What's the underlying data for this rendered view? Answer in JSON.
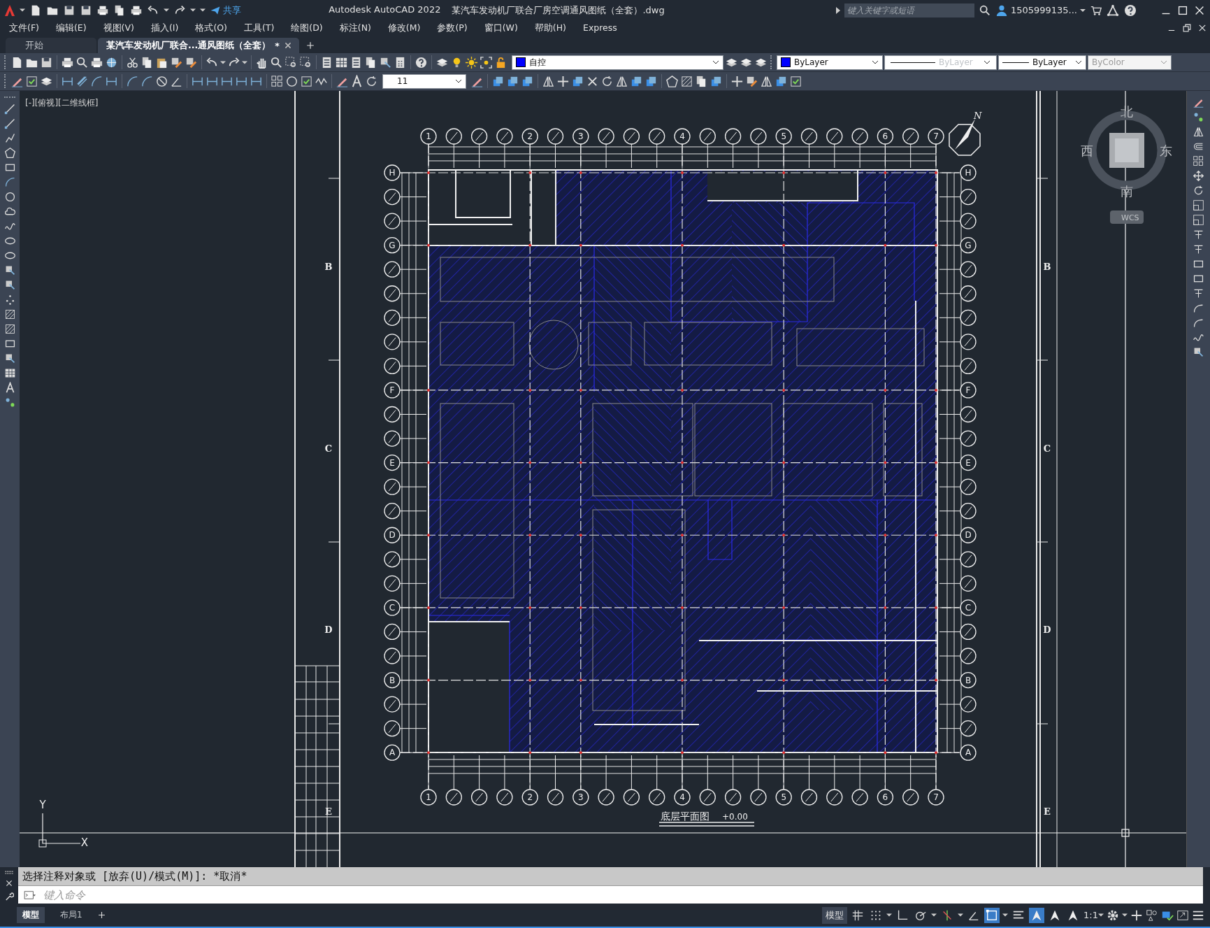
{
  "title_bar": {
    "share": "共享",
    "app": "Autodesk AutoCAD 2022",
    "file": "某汽车发动机厂联合厂房空调通风图纸（全套）.dwg",
    "search": {
      "placeholder": "键入关键字或短语"
    },
    "user": "1505999135..."
  },
  "menu": [
    "文件(F)",
    "编辑(E)",
    "视图(V)",
    "插入(I)",
    "格式(O)",
    "工具(T)",
    "绘图(D)",
    "标注(N)",
    "修改(M)",
    "参数(P)",
    "窗口(W)",
    "帮助(H)",
    "Express"
  ],
  "tabs": [
    {
      "label": "开始",
      "selected": false
    },
    {
      "label": "某汽车发动机厂联合...通风图纸（全套）",
      "mark": "*",
      "selected": true
    }
  ],
  "properties_toolbar": {
    "layer": "自控",
    "color_setting": "ByLayer",
    "linetype": "ByLayer",
    "lineweight": "ByLayer",
    "plot_style": {
      "label": "ByColor",
      "disabled": true
    }
  },
  "dim_style": "11",
  "viewport_label": "[-][俯视][二维线框]",
  "view_cube": {
    "north": "北",
    "south": "南",
    "west": "西",
    "east": "东",
    "ucs": "WCS"
  },
  "drawing": {
    "axes_top": [
      {
        "kind": "main",
        "label": "1"
      },
      {
        "kind": "sub"
      },
      {
        "kind": "sub"
      },
      {
        "kind": "sub"
      },
      {
        "kind": "main",
        "label": "2"
      },
      {
        "kind": "sub"
      },
      {
        "kind": "main",
        "label": "3"
      },
      {
        "kind": "sub"
      },
      {
        "kind": "sub"
      },
      {
        "kind": "sub"
      },
      {
        "kind": "main",
        "label": "4"
      },
      {
        "kind": "sub"
      },
      {
        "kind": "sub"
      },
      {
        "kind": "sub"
      },
      {
        "kind": "main",
        "label": "5"
      },
      {
        "kind": "sub"
      },
      {
        "kind": "sub"
      },
      {
        "kind": "sub"
      },
      {
        "kind": "main",
        "label": "6"
      },
      {
        "kind": "sub"
      },
      {
        "kind": "main",
        "label": "7"
      }
    ],
    "axes_bottom": [
      {
        "kind": "main",
        "label": "1"
      },
      {
        "kind": "sub"
      },
      {
        "kind": "sub"
      },
      {
        "kind": "sub"
      },
      {
        "kind": "main",
        "label": "2"
      },
      {
        "kind": "sub"
      },
      {
        "kind": "main",
        "label": "3"
      },
      {
        "kind": "sub"
      },
      {
        "kind": "sub"
      },
      {
        "kind": "sub"
      },
      {
        "kind": "main",
        "label": "4"
      },
      {
        "kind": "sub"
      },
      {
        "kind": "sub"
      },
      {
        "kind": "sub"
      },
      {
        "kind": "main",
        "label": "5"
      },
      {
        "kind": "sub"
      },
      {
        "kind": "sub"
      },
      {
        "kind": "sub"
      },
      {
        "kind": "main",
        "label": "6"
      },
      {
        "kind": "sub"
      },
      {
        "kind": "main",
        "label": "7"
      }
    ],
    "axes_left": [
      {
        "kind": "main",
        "label": "H"
      },
      {
        "kind": "sub"
      },
      {
        "kind": "sub"
      },
      {
        "kind": "main",
        "label": "G"
      },
      {
        "kind": "sub"
      },
      {
        "kind": "sub"
      },
      {
        "kind": "sub"
      },
      {
        "kind": "sub"
      },
      {
        "kind": "sub"
      },
      {
        "kind": "main",
        "label": "F"
      },
      {
        "kind": "sub"
      },
      {
        "kind": "sub"
      },
      {
        "kind": "main",
        "label": "E"
      },
      {
        "kind": "sub"
      },
      {
        "kind": "sub"
      },
      {
        "kind": "main",
        "label": "D"
      },
      {
        "kind": "sub"
      },
      {
        "kind": "sub"
      },
      {
        "kind": "main",
        "label": "C"
      },
      {
        "kind": "sub"
      },
      {
        "kind": "sub"
      },
      {
        "kind": "main",
        "label": "B"
      },
      {
        "kind": "sub"
      },
      {
        "kind": "sub"
      },
      {
        "kind": "main",
        "label": "A"
      }
    ],
    "axes_right": [
      {
        "kind": "main",
        "label": "H"
      },
      {
        "kind": "sub"
      },
      {
        "kind": "sub"
      },
      {
        "kind": "main",
        "label": "G"
      },
      {
        "kind": "sub"
      },
      {
        "kind": "sub"
      },
      {
        "kind": "sub"
      },
      {
        "kind": "sub"
      },
      {
        "kind": "sub"
      },
      {
        "kind": "main",
        "label": "F"
      },
      {
        "kind": "sub"
      },
      {
        "kind": "sub"
      },
      {
        "kind": "main",
        "label": "E"
      },
      {
        "kind": "sub"
      },
      {
        "kind": "sub"
      },
      {
        "kind": "main",
        "label": "D"
      },
      {
        "kind": "sub"
      },
      {
        "kind": "sub"
      },
      {
        "kind": "main",
        "label": "C"
      },
      {
        "kind": "sub"
      },
      {
        "kind": "sub"
      },
      {
        "kind": "main",
        "label": "B"
      },
      {
        "kind": "sub"
      },
      {
        "kind": "sub"
      },
      {
        "kind": "main",
        "label": "A"
      }
    ],
    "north": "N",
    "title": "底层平面图",
    "elevation": "+0.00",
    "zones_left": [
      "B",
      "C",
      "D",
      "E"
    ],
    "zones_right": [
      "B",
      "C",
      "D",
      "E"
    ]
  },
  "ucs_icon": {
    "x": "X",
    "y": "Y"
  },
  "command": {
    "history": "选择注释对象或 [放弃(U)/模式(M)]: *取消*",
    "placeholder": "键入命令"
  },
  "layout_tabs": [
    {
      "label": "模型",
      "selected": true
    },
    {
      "label": "布局1",
      "selected": false
    }
  ],
  "status_bar": {
    "space": "模型",
    "scale": "1:1",
    "toggles": [
      {
        "kind": "grid",
        "on": false
      },
      {
        "kind": "snap",
        "on": false
      },
      {
        "kind": "ortho",
        "on": false
      },
      {
        "kind": "polar",
        "on": false
      },
      {
        "kind": "osnap",
        "on": false
      },
      {
        "kind": "angle",
        "on": false
      },
      {
        "kind": "selection",
        "on": true
      },
      {
        "kind": "lineweight",
        "on": false
      },
      {
        "kind": "anno_visibility",
        "on": true
      },
      {
        "kind": "auto_scale",
        "on": false
      },
      {
        "kind": "anno_scale",
        "on": false
      }
    ]
  }
}
